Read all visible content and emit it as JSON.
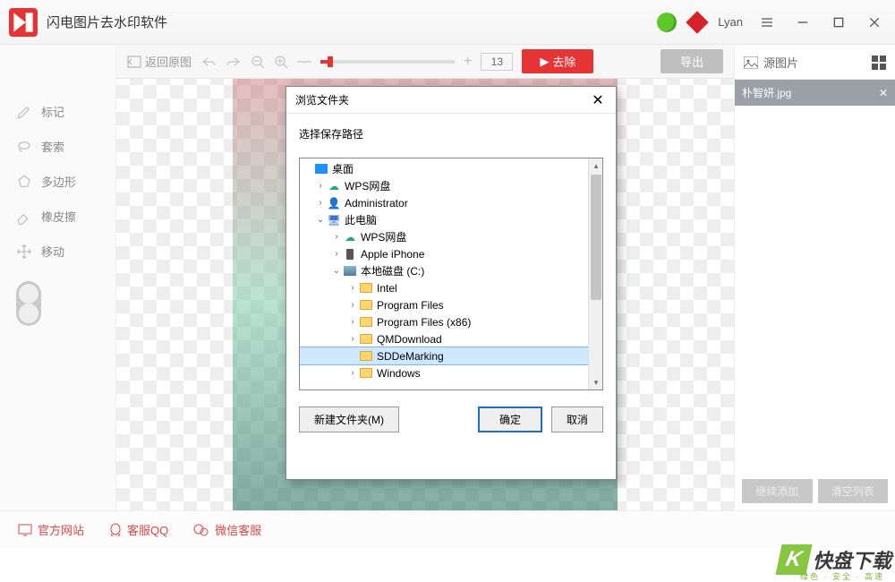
{
  "titlebar": {
    "app_title": "闪电图片去水印软件",
    "username": "Lyan"
  },
  "toolbar": {
    "reset": "返回原图",
    "brush_value": "13",
    "remove": "去除",
    "export": "导出"
  },
  "sidebar": {
    "mark": "标记",
    "lasso": "套索",
    "polygon": "多边形",
    "eraser": "橡皮擦",
    "move": "移动"
  },
  "rightpanel": {
    "title": "源图片",
    "file": "朴智妍.jpg",
    "btn_add": "继续添加",
    "btn_clear": "清空列表"
  },
  "footer": {
    "site": "官方网站",
    "qq": "客服QQ",
    "wechat": "微信客服"
  },
  "dialog": {
    "title": "浏览文件夹",
    "label": "选择保存路径",
    "new_folder": "新建文件夹(M)",
    "ok": "确定",
    "cancel": "取消",
    "tree": {
      "desktop": "桌面",
      "wps": "WPS网盘",
      "admin": "Administrator",
      "thispc": "此电脑",
      "wps2": "WPS网盘",
      "iphone": "Apple iPhone",
      "cdrive": "本地磁盘 (C:)",
      "intel": "Intel",
      "pf": "Program Files",
      "pf86": "Program Files (x86)",
      "qm": "QMDownload",
      "sdd": "SDDeMarking",
      "win": "Windows"
    }
  },
  "watermark": {
    "text": "快盘下载",
    "sub": "绿色 · 安全 · 高速"
  }
}
